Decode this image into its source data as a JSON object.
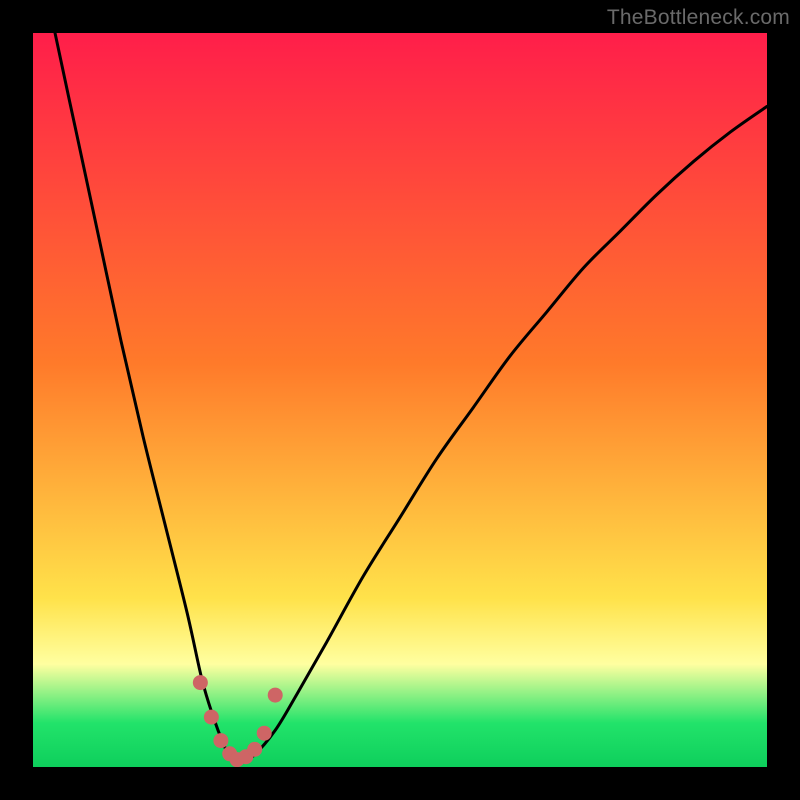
{
  "source_label": "TheBottleneck.com",
  "colors": {
    "top": "#ff1e4a",
    "orange": "#ff7a2a",
    "yellow": "#ffe24a",
    "pale_yellow": "#ffffa0",
    "green": "#22e36a",
    "deep_green": "#0ecf5c",
    "curve": "#000000",
    "marker": "#ce6565",
    "frame": "#000000"
  },
  "chart_data": {
    "type": "line",
    "title": "",
    "xlabel": "",
    "ylabel": "",
    "xlim": [
      0,
      100
    ],
    "ylim": [
      0,
      100
    ],
    "grid": false,
    "legend": false,
    "series": [
      {
        "name": "bottleneck-curve",
        "x": [
          0,
          3,
          6,
          9,
          12,
          15,
          18,
          21,
          23,
          24.5,
          26,
          27,
          28,
          30,
          33,
          36,
          40,
          45,
          50,
          55,
          60,
          65,
          70,
          75,
          80,
          85,
          90,
          95,
          100
        ],
        "y": [
          115,
          100,
          86,
          72,
          58,
          45,
          33,
          21,
          12,
          7,
          3,
          1,
          0.5,
          1.5,
          5,
          10,
          17,
          26,
          34,
          42,
          49,
          56,
          62,
          68,
          73,
          78,
          82.5,
          86.5,
          90
        ]
      }
    ],
    "markers": {
      "name": "near-optimum-points",
      "x": [
        22.8,
        24.3,
        25.6,
        26.8,
        27.8,
        29.0,
        30.2,
        31.5,
        33.0
      ],
      "y": [
        11.5,
        6.8,
        3.6,
        1.8,
        1.0,
        1.4,
        2.4,
        4.6,
        9.8
      ]
    },
    "gradient_stops": [
      {
        "offset": 0,
        "color_key": "top"
      },
      {
        "offset": 45,
        "color_key": "orange"
      },
      {
        "offset": 77,
        "color_key": "yellow"
      },
      {
        "offset": 86,
        "color_key": "pale_yellow"
      },
      {
        "offset": 94,
        "color_key": "green"
      },
      {
        "offset": 100,
        "color_key": "deep_green"
      }
    ]
  }
}
